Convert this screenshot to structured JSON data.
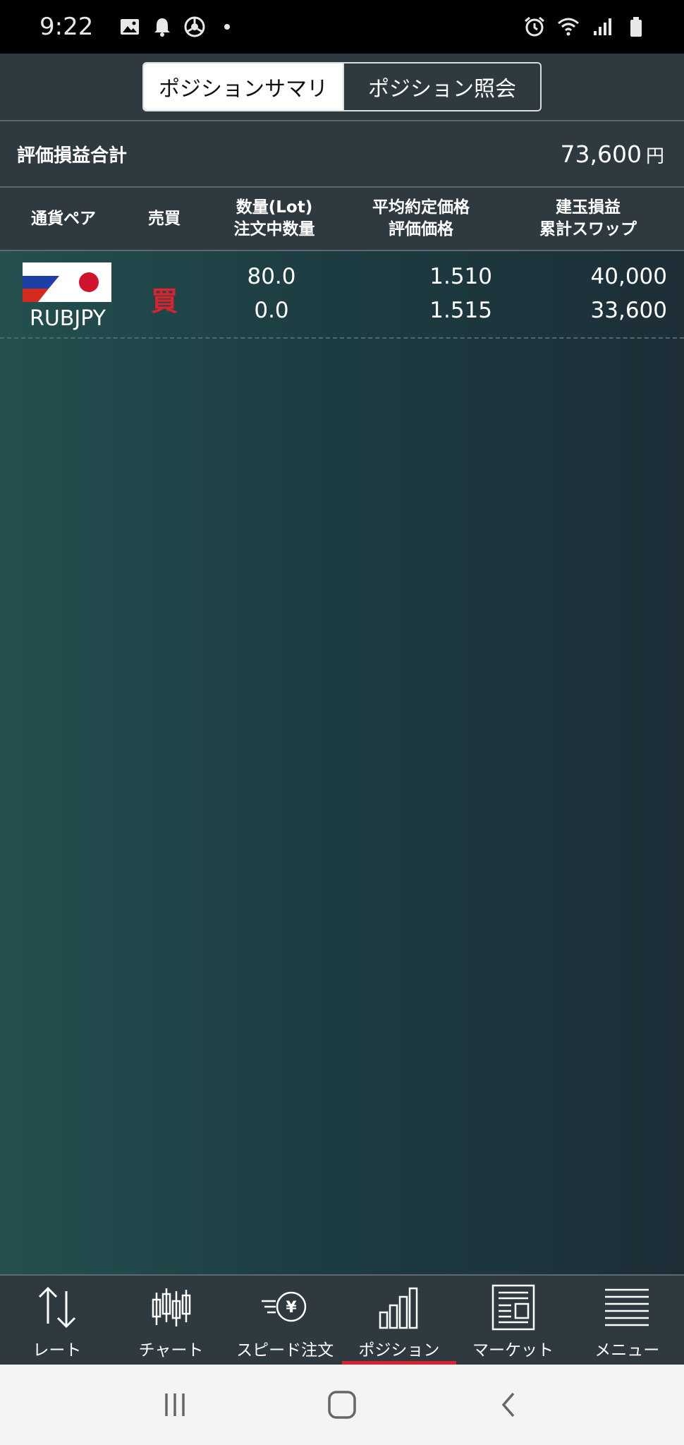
{
  "status_bar": {
    "time": "9:22"
  },
  "tabs": [
    {
      "label": "ポジションサマリ",
      "active": true
    },
    {
      "label": "ポジション照会",
      "active": false
    }
  ],
  "summary": {
    "label": "評価損益合計",
    "value": "73,600",
    "unit": "円"
  },
  "table": {
    "headers": {
      "pair": "通貨ペア",
      "side": "売買",
      "qty_top": "数量(Lot)",
      "qty_bottom": "注文中数量",
      "price_top": "平均約定価格",
      "price_bottom": "評価価格",
      "pl_top": "建玉損益",
      "pl_bottom": "累計スワップ"
    },
    "rows": [
      {
        "pair": "RUBJPY",
        "side": "買",
        "quantity": "80.0",
        "order_quantity": "0.0",
        "avg_price": "1.510",
        "eval_price": "1.515",
        "position_pl": "40,000",
        "swap": "33,600"
      }
    ]
  },
  "bottom_nav": [
    {
      "label": "レート",
      "icon": "updown-arrows-icon"
    },
    {
      "label": "チャート",
      "icon": "candlestick-icon"
    },
    {
      "label": "スピード注文",
      "icon": "speed-yen-icon"
    },
    {
      "label": "ポジション",
      "icon": "bar-chart-icon",
      "active": true
    },
    {
      "label": "マーケット",
      "icon": "newspaper-icon"
    },
    {
      "label": "メニュー",
      "icon": "menu-lines-icon"
    }
  ],
  "colors": {
    "accent_red": "#d9232e",
    "panel": "#2f3a40"
  }
}
